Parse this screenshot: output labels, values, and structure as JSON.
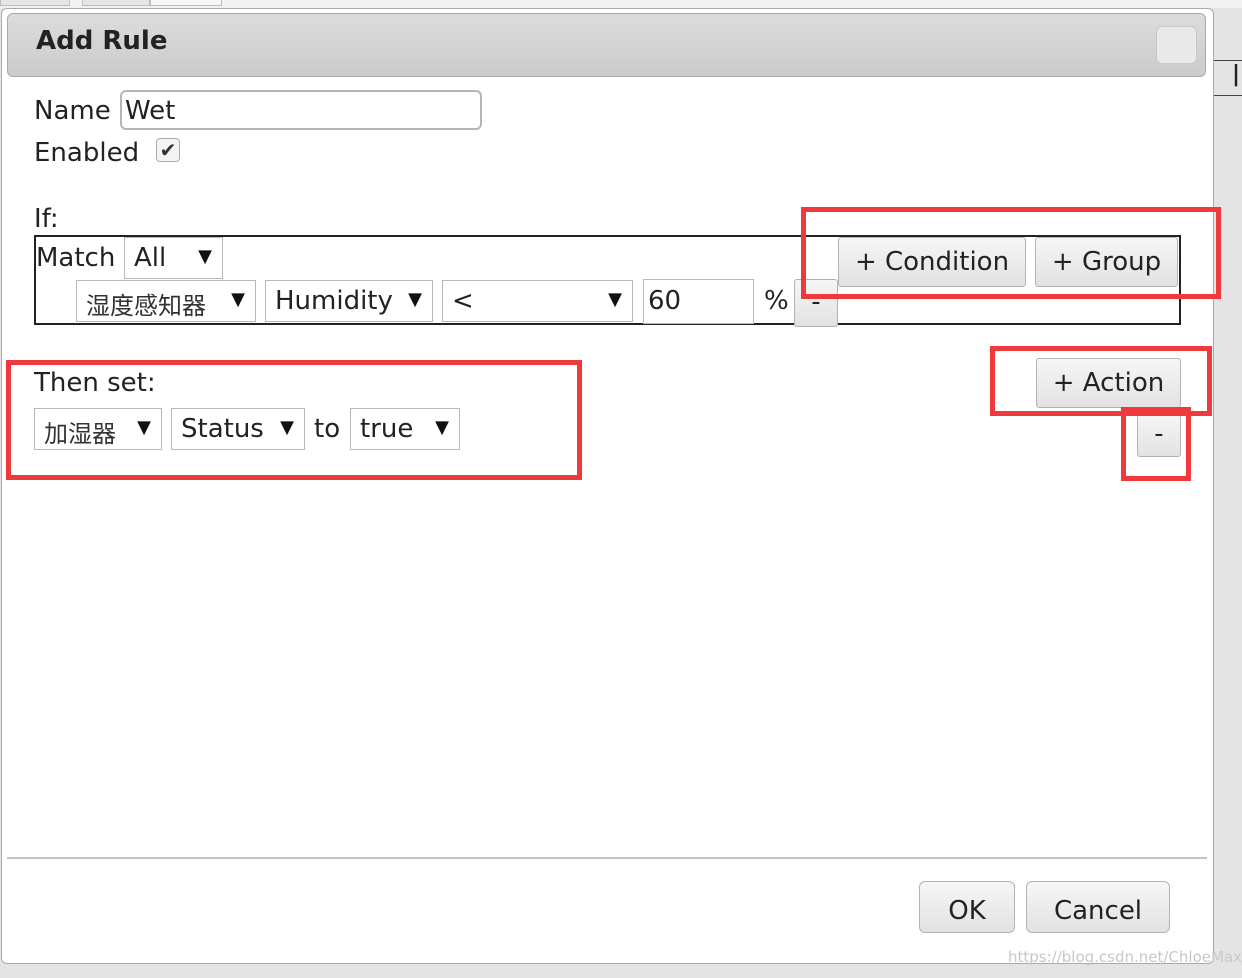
{
  "dialog": {
    "title": "Add Rule",
    "name_label": "Name",
    "name_value": "Wet",
    "enabled_label": "Enabled",
    "enabled_checked": true,
    "if_label": "If:",
    "match_label": "Match",
    "match_value": "All",
    "condition": {
      "device": "湿度感知器",
      "property": "Humidity",
      "operator": "<",
      "value": "60",
      "unit": "%",
      "remove_label": "-"
    },
    "add_condition_label": "+ Condition",
    "add_group_label": "+ Group",
    "then_label": "Then set:",
    "action": {
      "device": "加湿器",
      "property": "Status",
      "to_label": "to",
      "value": "true"
    },
    "add_action_label": "+ Action",
    "remove_action_label": "-",
    "ok_label": "OK",
    "cancel_label": "Cancel"
  },
  "icons": {
    "caret": "▼",
    "check": "✔"
  },
  "annotation_color": "#ef3a3d",
  "watermark": "https://blog.csdn.net/ChloeMax_"
}
